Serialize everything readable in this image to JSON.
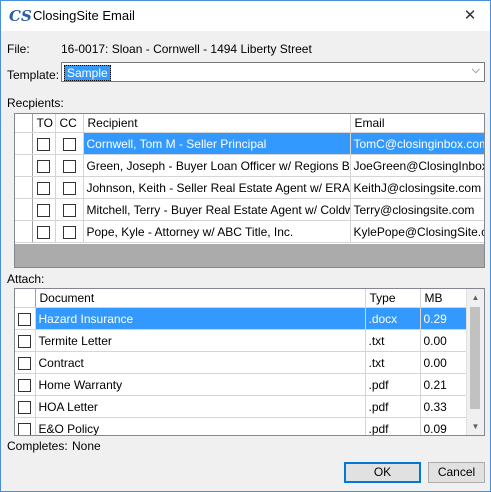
{
  "window": {
    "title": "ClosingSite Email",
    "close_glyph": "✕",
    "app_icon_glyph": "CS"
  },
  "file": {
    "label": "File:",
    "value": "16-0017: Sloan - Cornwell - 1494 Liberty Street"
  },
  "template": {
    "label": "Template:",
    "value": "Sample",
    "dropdown_glyph": "⌵"
  },
  "recipients": {
    "label": "Recpients:",
    "columns": {
      "to": "TO",
      "cc": "CC",
      "recipient": "Recipient",
      "email": "Email"
    },
    "rows": [
      {
        "recipient": "Cornwell, Tom M - Seller  Principal",
        "email": "TomC@closinginbox.com",
        "selected": true
      },
      {
        "recipient": "Green, Joseph -  Buyer  Loan Officer  w/ Regions Ba...",
        "email": "JoeGreen@ClosingInbox.com",
        "selected": false
      },
      {
        "recipient": "Johnson, Keith -  Seller  Real Estate Agent  w/ ERA ...",
        "email": "KeithJ@closingsite.com",
        "selected": false
      },
      {
        "recipient": "Mitchell, Terry -  Buyer  Real Estate Agent  w/ Coldw...",
        "email": "Terry@closingsite.com",
        "selected": false
      },
      {
        "recipient": "Pope, Kyle - Attorney  w/ ABC Title, Inc.",
        "email": "KylePope@ClosingSite.com",
        "selected": false
      }
    ]
  },
  "attach": {
    "label": "Attach:",
    "columns": {
      "document": "Document",
      "type": "Type",
      "mb": "MB"
    },
    "rows": [
      {
        "document": "Hazard Insurance",
        "type": ".docx",
        "mb": "0.29",
        "selected": true
      },
      {
        "document": "Termite Letter",
        "type": ".txt",
        "mb": "0.00",
        "selected": false
      },
      {
        "document": "Contract",
        "type": ".txt",
        "mb": "0.00",
        "selected": false
      },
      {
        "document": "Home Warranty",
        "type": ".pdf",
        "mb": "0.21",
        "selected": false
      },
      {
        "document": "HOA Letter",
        "type": ".pdf",
        "mb": "0.33",
        "selected": false
      },
      {
        "document": "E&O Policy",
        "type": ".pdf",
        "mb": "0.09",
        "selected": false
      }
    ],
    "scroll_up_glyph": "▲",
    "scroll_down_glyph": "▼"
  },
  "completes": {
    "label": "Completes:",
    "value": "None"
  },
  "buttons": {
    "ok": "OK",
    "cancel": "Cancel"
  },
  "colors": {
    "selection": "#3399ff",
    "focus_border": "#0078d7",
    "grey_area": "#ababab"
  }
}
